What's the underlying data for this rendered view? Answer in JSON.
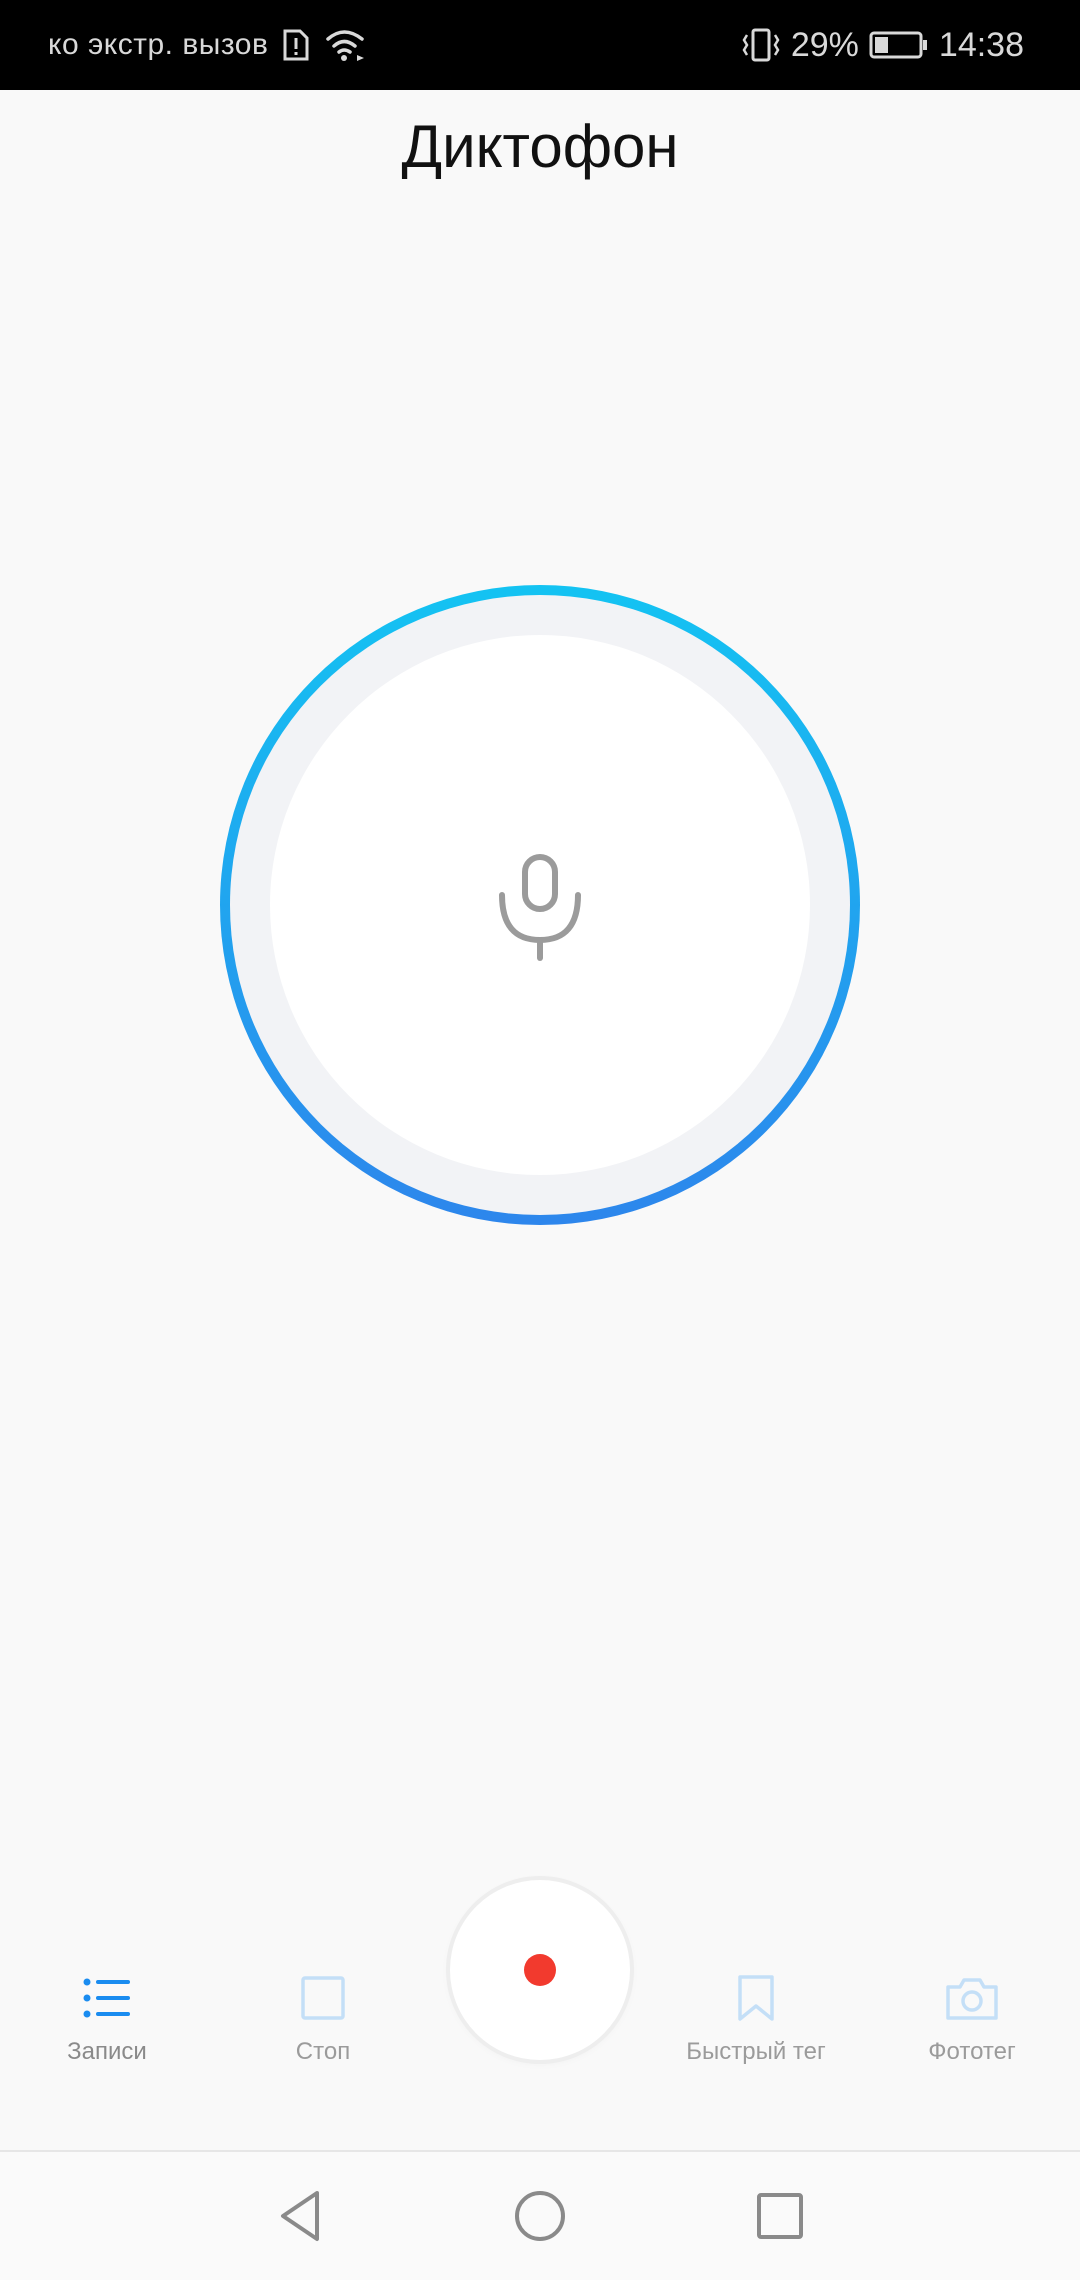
{
  "status_bar": {
    "carrier": "ко экстр. вызов",
    "battery": "29%",
    "time": "14:38",
    "icons": [
      "sim-alert-icon",
      "wifi-icon",
      "vibrate-icon",
      "battery-icon"
    ]
  },
  "app": {
    "title": "Диктофон"
  },
  "recorder": {
    "icon": "microphone-icon",
    "ring_gradient": [
      "#14c3f2",
      "#2d86ec"
    ],
    "record_color": "#f23a2e"
  },
  "toolbar": {
    "records_label": "Записи",
    "stop_label": "Стоп",
    "quick_tag_label": "Быстрый тег",
    "photo_tag_label": "Фототег",
    "accent_color": "#1a8cf0"
  },
  "nav_bar": {
    "icons": [
      "back-icon",
      "home-icon",
      "recents-icon"
    ]
  }
}
